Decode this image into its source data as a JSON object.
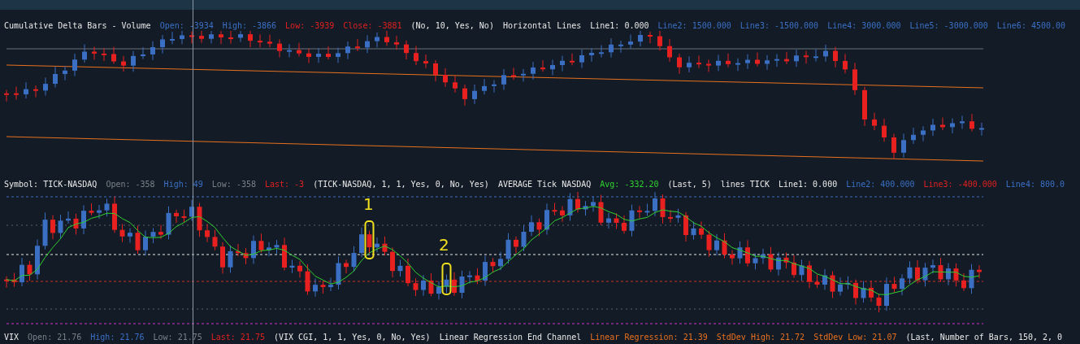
{
  "panels": [
    {
      "header": [
        {
          "text": "Cumulative Delta Bars - Volume",
          "color": "#e8e8e8"
        },
        {
          "text": "Open: -3934",
          "color": "#3a6fc4"
        },
        {
          "text": "High: -3866",
          "color": "#3a6fc4"
        },
        {
          "text": "Low: -3939",
          "color": "#e02020"
        },
        {
          "text": "Close: -3881",
          "color": "#e02020"
        },
        {
          "text": "(No, 10, Yes, No)",
          "color": "#e8e8e8"
        },
        {
          "text": "Horizontal Lines",
          "color": "#e8e8e8"
        },
        {
          "text": "Line1: 0.000",
          "color": "#e8e8e8"
        },
        {
          "text": "Line2: 1500.000",
          "color": "#3a6fc4"
        },
        {
          "text": "Line3: -1500.000",
          "color": "#3a6fc4"
        },
        {
          "text": "Line4: 3000.000",
          "color": "#3a6fc4"
        },
        {
          "text": "Line5: -3000.000",
          "color": "#3a6fc4"
        },
        {
          "text": "Line6: 4500.00",
          "color": "#3a6fc4"
        }
      ]
    },
    {
      "header": [
        {
          "text": "Symbol: TICK-NASDAQ",
          "color": "#e8e8e8"
        },
        {
          "text": "Open: -358",
          "color": "#7a8088"
        },
        {
          "text": "High: 49",
          "color": "#3a6fc4"
        },
        {
          "text": "Low: -358",
          "color": "#7a8088"
        },
        {
          "text": "Last: -3",
          "color": "#e02020"
        },
        {
          "text": "(TICK-NASDAQ, 1, 1, Yes, 0, No, Yes)",
          "color": "#e8e8e8"
        },
        {
          "text": "AVERAGE Tick NASDAQ",
          "color": "#e8e8e8"
        },
        {
          "text": "Avg: -332.20",
          "color": "#30d030"
        },
        {
          "text": "(Last, 5)",
          "color": "#e8e8e8"
        },
        {
          "text": "lines TICK",
          "color": "#e8e8e8"
        },
        {
          "text": "Line1: 0.000",
          "color": "#e8e8e8"
        },
        {
          "text": "Line2: 400.000",
          "color": "#3a6fc4"
        },
        {
          "text": "Line3: -400.000",
          "color": "#e02020"
        },
        {
          "text": "Line4: 800.0",
          "color": "#3a6fc4"
        }
      ]
    },
    {
      "header": [
        {
          "text": "VIX",
          "color": "#e8e8e8"
        },
        {
          "text": "Open: 21.76",
          "color": "#7a8088"
        },
        {
          "text": "High: 21.76",
          "color": "#3a6fc4"
        },
        {
          "text": "Low: 21.75",
          "color": "#7a8088"
        },
        {
          "text": "Last: 21.75",
          "color": "#e02020"
        },
        {
          "text": "(VIX CGI, 1, 1, Yes, 0, No, Yes)",
          "color": "#e8e8e8"
        },
        {
          "text": "Linear Regression End Channel",
          "color": "#e8e8e8"
        },
        {
          "text": "Linear Regression: 21.39",
          "color": "#e87020"
        },
        {
          "text": "StdDev High: 21.72",
          "color": "#e87020"
        },
        {
          "text": "StdDev Low: 21.07",
          "color": "#e87020"
        },
        {
          "text": "(Last, Number of Bars, 150, 2, 0",
          "color": "#e8e8e8"
        }
      ]
    }
  ],
  "annotations": [
    {
      "text": "1"
    },
    {
      "text": "2"
    }
  ]
}
